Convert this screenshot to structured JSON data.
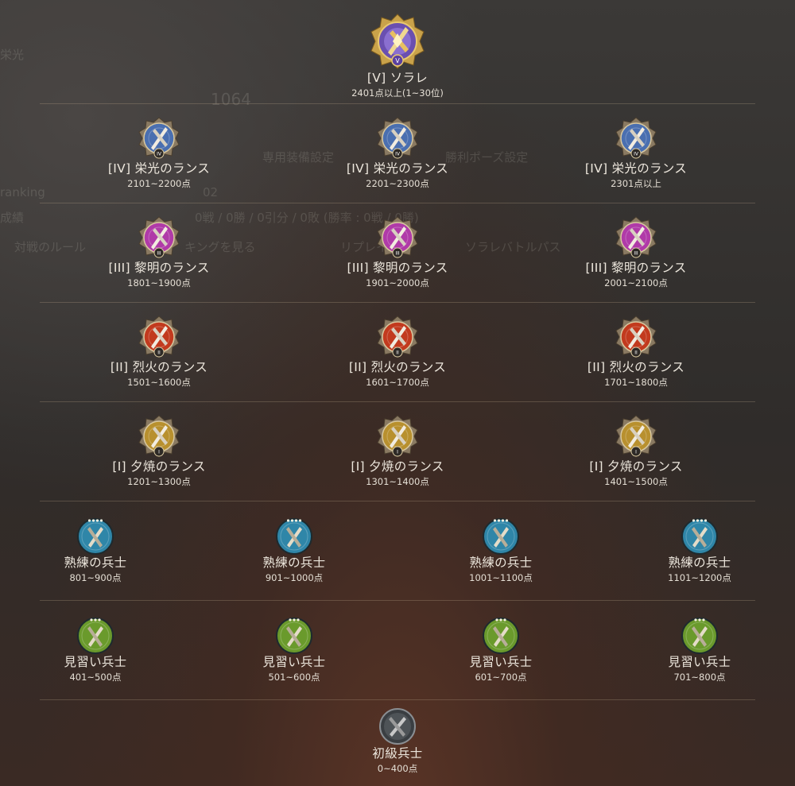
{
  "background_ui": {
    "tabs": [
      "対戦のルール",
      "キングを見る",
      "リプレイ",
      "ソラレバトルパス"
    ],
    "labels": [
      "専用装備設定",
      "勝利ポーズ設定",
      "ranking",
      "成績",
      "0戦 / 0勝 / 0引分 / 0敗 (勝率 : 0戦 / 0勝)",
      "02",
      "1064",
      "栄光"
    ]
  },
  "tiers": {
    "top": {
      "name": "[V] ソラレ",
      "range": "2401点以上(1~30位)",
      "icon": "solare-v-emblem-icon",
      "color": "#7a5bc0"
    },
    "glory": [
      {
        "name": "[IV] 栄光のランス",
        "range": "2101~2200点",
        "icon": "glory-lance-iv-icon",
        "color": "#4a6fb0"
      },
      {
        "name": "[IV] 栄光のランス",
        "range": "2201~2300点",
        "icon": "glory-lance-iv-icon",
        "color": "#4a6fb0"
      },
      {
        "name": "[IV] 栄光のランス",
        "range": "2301点以上",
        "icon": "glory-lance-iv-icon",
        "color": "#4a6fb0"
      }
    ],
    "dawn": [
      {
        "name": "[III] 黎明のランス",
        "range": "1801~1900点",
        "icon": "dawn-lance-iii-icon",
        "color": "#b03aa8"
      },
      {
        "name": "[III] 黎明のランス",
        "range": "1901~2000点",
        "icon": "dawn-lance-iii-icon",
        "color": "#b03aa8"
      },
      {
        "name": "[III] 黎明のランス",
        "range": "2001~2100点",
        "icon": "dawn-lance-iii-icon",
        "color": "#b03aa8"
      }
    ],
    "flame": [
      {
        "name": "[II] 烈火のランス",
        "range": "1501~1600点",
        "icon": "flame-lance-ii-icon",
        "color": "#c23a1e"
      },
      {
        "name": "[II] 烈火のランス",
        "range": "1601~1700点",
        "icon": "flame-lance-ii-icon",
        "color": "#c23a1e"
      },
      {
        "name": "[II] 烈火のランス",
        "range": "1701~1800点",
        "icon": "flame-lance-ii-icon",
        "color": "#c23a1e"
      }
    ],
    "sunset": [
      {
        "name": "[I] 夕焼のランス",
        "range": "1201~1300点",
        "icon": "sunset-lance-i-icon",
        "color": "#b8902e"
      },
      {
        "name": "[I] 夕焼のランス",
        "range": "1301~1400点",
        "icon": "sunset-lance-i-icon",
        "color": "#b8902e"
      },
      {
        "name": "[I] 夕焼のランス",
        "range": "1401~1500点",
        "icon": "sunset-lance-i-icon",
        "color": "#b8902e"
      }
    ],
    "veteran": [
      {
        "name": "熟練の兵士",
        "range": "801~900点",
        "icon": "veteran-soldier-icon",
        "color": "#2f86a8"
      },
      {
        "name": "熟練の兵士",
        "range": "901~1000点",
        "icon": "veteran-soldier-icon",
        "color": "#2f86a8"
      },
      {
        "name": "熟練の兵士",
        "range": "1001~1100点",
        "icon": "veteran-soldier-icon",
        "color": "#2f86a8"
      },
      {
        "name": "熟練の兵士",
        "range": "1101~1200点",
        "icon": "veteran-soldier-icon",
        "color": "#2f86a8"
      }
    ],
    "apprentice": [
      {
        "name": "見習い兵士",
        "range": "401~500点",
        "icon": "apprentice-soldier-icon",
        "color": "#6a9a2c"
      },
      {
        "name": "見習い兵士",
        "range": "501~600点",
        "icon": "apprentice-soldier-icon",
        "color": "#6a9a2c"
      },
      {
        "name": "見習い兵士",
        "range": "601~700点",
        "icon": "apprentice-soldier-icon",
        "color": "#6a9a2c"
      },
      {
        "name": "見習い兵士",
        "range": "701~800点",
        "icon": "apprentice-soldier-icon",
        "color": "#6a9a2c"
      }
    ],
    "novice": {
      "name": "初級兵士",
      "range": "0~400点",
      "icon": "novice-soldier-icon",
      "color": "#5a5e62"
    }
  }
}
